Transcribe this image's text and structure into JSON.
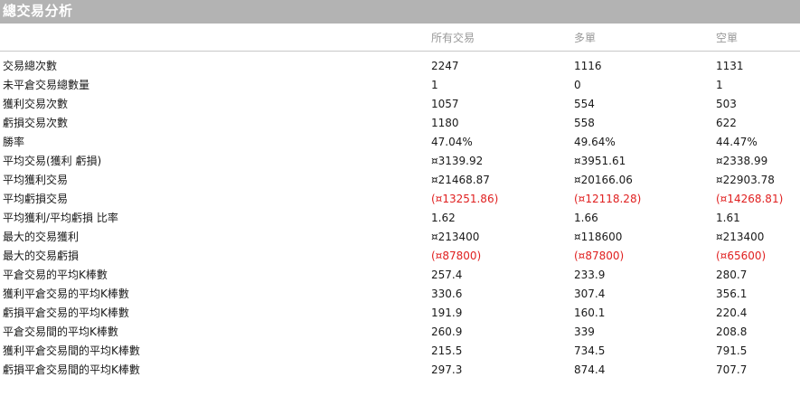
{
  "title": "總交易分析",
  "columns": [
    "所有交易",
    "多單",
    "空單"
  ],
  "rows": [
    {
      "label": "交易總次數",
      "values": [
        "2247",
        "1116",
        "1131"
      ],
      "negative": false
    },
    {
      "label": "未平倉交易總數量",
      "values": [
        "1",
        "0",
        "1"
      ],
      "negative": false
    },
    {
      "label": "獲利交易次數",
      "values": [
        "1057",
        "554",
        "503"
      ],
      "negative": false
    },
    {
      "label": "虧損交易次數",
      "values": [
        "1180",
        "558",
        "622"
      ],
      "negative": false
    },
    {
      "label": "勝率",
      "values": [
        "47.04%",
        "49.64%",
        "44.47%"
      ],
      "negative": false
    },
    {
      "label": "平均交易(獲利 虧損)",
      "values": [
        "¤3139.92",
        "¤3951.61",
        "¤2338.99"
      ],
      "negative": false
    },
    {
      "label": "平均獲利交易",
      "values": [
        "¤21468.87",
        "¤20166.06",
        "¤22903.78"
      ],
      "negative": false
    },
    {
      "label": "平均虧損交易",
      "values": [
        "(¤13251.86)",
        "(¤12118.28)",
        "(¤14268.81)"
      ],
      "negative": true
    },
    {
      "label": "平均獲利/平均虧損 比率",
      "values": [
        "1.62",
        "1.66",
        "1.61"
      ],
      "negative": false
    },
    {
      "label": "最大的交易獲利",
      "values": [
        "¤213400",
        "¤118600",
        "¤213400"
      ],
      "negative": false
    },
    {
      "label": "最大的交易虧損",
      "values": [
        "(¤87800)",
        "(¤87800)",
        "(¤65600)"
      ],
      "negative": true
    },
    {
      "label": "平倉交易的平均K棒數",
      "values": [
        "257.4",
        "233.9",
        "280.7"
      ],
      "negative": false
    },
    {
      "label": "獲利平倉交易的平均K棒數",
      "values": [
        "330.6",
        "307.4",
        "356.1"
      ],
      "negative": false
    },
    {
      "label": "虧損平倉交易的平均K棒數",
      "values": [
        "191.9",
        "160.1",
        "220.4"
      ],
      "negative": false
    },
    {
      "label": "平倉交易間的平均K棒數",
      "values": [
        "260.9",
        "339",
        "208.8"
      ],
      "negative": false
    },
    {
      "label": "獲利平倉交易間的平均K棒數",
      "values": [
        "215.5",
        "734.5",
        "791.5"
      ],
      "negative": false
    },
    {
      "label": "虧損平倉交易間的平均K棒數",
      "values": [
        "297.3",
        "874.4",
        "707.7"
      ],
      "negative": false
    }
  ],
  "colors": {
    "title_bg": "#b3b3b3",
    "negative": "#e02020",
    "header_text": "#999999"
  }
}
